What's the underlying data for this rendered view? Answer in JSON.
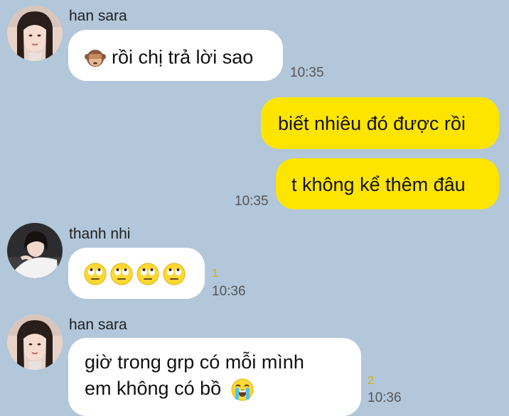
{
  "messages": [
    {
      "sender": "han sara",
      "text": "rồi chị trả lời sao",
      "time": "10:35"
    },
    {
      "text_1": "biết nhiêu đó được rồi",
      "text_2": "t không kể thêm đâu",
      "time": "10:35"
    },
    {
      "sender": "thanh nhi",
      "unread": "1",
      "time": "10:36"
    },
    {
      "sender": "han sara",
      "line_1": "giờ trong grp có mỗi mình",
      "line_2": "em không có bồ",
      "unread": "2",
      "time": "10:36"
    }
  ],
  "icons": {
    "monkey": "see-no-evil-monkey-icon",
    "eyeroll": "face-with-rolling-eyes-icon",
    "crying": "loudly-crying-face-icon"
  },
  "colors": {
    "background": "#b2c7da",
    "incoming_bubble": "#ffffff",
    "outgoing_bubble": "#fee500",
    "unread_count": "#d4b300"
  }
}
